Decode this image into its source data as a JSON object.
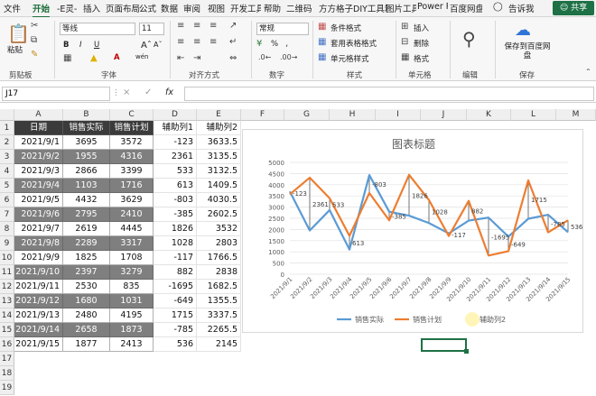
{
  "menu": {
    "items": [
      "文件",
      "开始",
      "-E灵-",
      "插入",
      "页面布局",
      "公式",
      "数据",
      "审阅",
      "视图",
      "开发工具",
      "帮助",
      "二维码",
      "方方格子",
      "DIY工具箱",
      "图片工具",
      "Power P",
      "百度网盘"
    ],
    "tell_me": "告诉我",
    "share": "共享"
  },
  "ribbon": {
    "paste": "粘贴",
    "clipboard": "剪贴板",
    "font_name": "等线",
    "font_size": "11",
    "font_group": "字体",
    "bold": "B",
    "italic": "I",
    "underline": "U",
    "font_color": "A",
    "wen": "wén",
    "align_group": "对齐方式",
    "number_format": "常规",
    "number_group": "数字",
    "percent": "%",
    "cond_format": "条件格式",
    "table_format": "套用表格格式",
    "cell_style": "单元格样式",
    "styles_group": "样式",
    "insert": "插入",
    "delete": "删除",
    "format": "格式",
    "cells_group": "单元格",
    "edit_group": "编辑",
    "save_baidu": "保存到百度网盘",
    "save_group": "保存"
  },
  "formula": {
    "name_box": "J17",
    "fx": "fx",
    "cancel": "×",
    "confirm": "✓"
  },
  "grid": {
    "columns": [
      "A",
      "B",
      "C",
      "D",
      "E",
      "F",
      "G",
      "H",
      "I",
      "J",
      "K",
      "L",
      "M"
    ],
    "rows": [
      "1",
      "2",
      "3",
      "4",
      "5",
      "6",
      "7",
      "8",
      "9",
      "10",
      "11",
      "12",
      "13",
      "14",
      "15",
      "16",
      "17",
      "18",
      "19"
    ],
    "headers": [
      "日期",
      "销售实际",
      "销售计划",
      "辅助列1",
      "辅助列2"
    ],
    "data": [
      [
        "2021/9/1",
        "3695",
        "3572",
        "-123",
        "3633.5"
      ],
      [
        "2021/9/2",
        "1955",
        "4316",
        "2361",
        "3135.5"
      ],
      [
        "2021/9/3",
        "2866",
        "3399",
        "533",
        "3132.5"
      ],
      [
        "2021/9/4",
        "1103",
        "1716",
        "613",
        "1409.5"
      ],
      [
        "2021/9/5",
        "4432",
        "3629",
        "-803",
        "4030.5"
      ],
      [
        "2021/9/6",
        "2795",
        "2410",
        "-385",
        "2602.5"
      ],
      [
        "2021/9/7",
        "2619",
        "4445",
        "1826",
        "3532"
      ],
      [
        "2021/9/8",
        "2289",
        "3317",
        "1028",
        "2803"
      ],
      [
        "2021/9/9",
        "1825",
        "1708",
        "-117",
        "1766.5"
      ],
      [
        "2021/9/10",
        "2397",
        "3279",
        "882",
        "2838"
      ],
      [
        "2021/9/11",
        "2530",
        "835",
        "-1695",
        "1682.5"
      ],
      [
        "2021/9/12",
        "1680",
        "1031",
        "-649",
        "1355.5"
      ],
      [
        "2021/9/13",
        "2480",
        "4195",
        "1715",
        "3337.5"
      ],
      [
        "2021/9/14",
        "2658",
        "1873",
        "-785",
        "2265.5"
      ],
      [
        "2021/9/15",
        "1877",
        "2413",
        "536",
        "2145"
      ]
    ]
  },
  "chart_data": {
    "type": "line",
    "title": "图表标题",
    "categories": [
      "2021/9/1",
      "2021/9/2",
      "2021/9/3",
      "2021/9/4",
      "2021/9/5",
      "2021/9/6",
      "2021/9/7",
      "2021/9/8",
      "2021/9/9",
      "2021/9/10",
      "2021/9/11",
      "2021/9/12",
      "2021/9/13",
      "2021/9/14",
      "2021/9/15"
    ],
    "series": [
      {
        "name": "销售实际",
        "color": "#5b9bd5",
        "values": [
          3695,
          1955,
          2866,
          1103,
          4432,
          2795,
          2619,
          2289,
          1825,
          2397,
          2530,
          1680,
          2480,
          2658,
          1877
        ]
      },
      {
        "name": "销售计划",
        "color": "#ed7d31",
        "values": [
          3572,
          4316,
          3399,
          1716,
          3629,
          2410,
          4445,
          3317,
          1708,
          3279,
          835,
          1031,
          4195,
          1873,
          2413
        ]
      }
    ],
    "helper": {
      "name": "辅助列2",
      "values": [
        3633.5,
        3135.5,
        3132.5,
        1409.5,
        4030.5,
        2602.5,
        3532,
        2803,
        1766.5,
        2838,
        1682.5,
        1355.5,
        3337.5,
        2265.5,
        2145
      ],
      "labels": [
        "-123",
        "2361",
        "533",
        "613",
        "-803",
        "-385",
        "1826",
        "1028",
        "-117",
        "882",
        "-1695",
        "-649",
        "1715",
        "-785",
        "536"
      ]
    },
    "yticks": [
      "0",
      "500",
      "1000",
      "1500",
      "2000",
      "2500",
      "3000",
      "3500",
      "4000",
      "4500",
      "5000"
    ],
    "ylim": [
      0,
      5000
    ],
    "legend": "bottom"
  }
}
